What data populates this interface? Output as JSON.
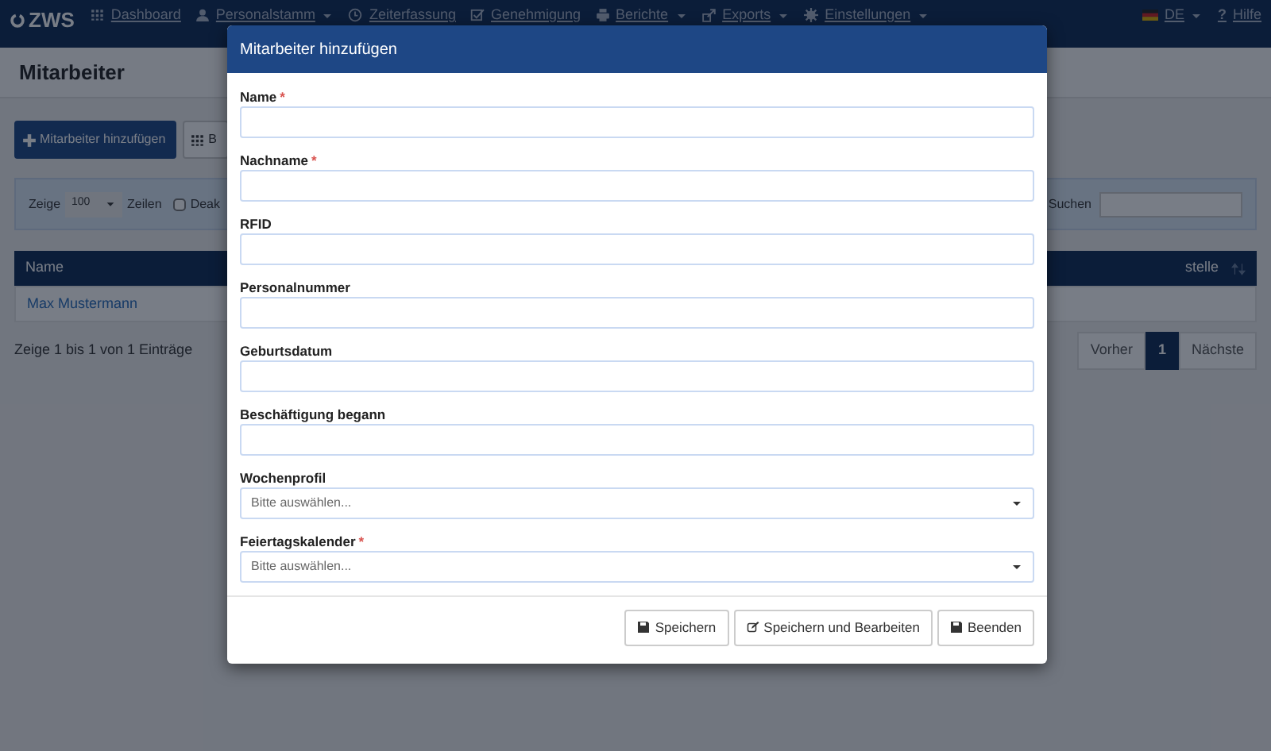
{
  "navbar": {
    "brand": "ZWS",
    "items": [
      {
        "label": "Dashboard",
        "dropdown": false
      },
      {
        "label": "Personalstamm",
        "dropdown": true
      },
      {
        "label": "Zeiterfassung",
        "dropdown": false
      },
      {
        "label": "Genehmigung",
        "dropdown": false
      },
      {
        "label": "Berichte",
        "dropdown": true
      },
      {
        "label": "Exports",
        "dropdown": true
      },
      {
        "label": "Einstellungen",
        "dropdown": true
      }
    ],
    "language": "DE",
    "help_icon": "?",
    "help": "Hilfe"
  },
  "page": {
    "title": "Mitarbeiter",
    "buttons": [
      {
        "label": "Mitarbeiter hinzufügen",
        "kind": "primary"
      },
      {
        "label": "B",
        "kind": "default"
      }
    ],
    "filter": {
      "show_label": "Zeige",
      "rows_value": "100",
      "rows_label": "Zeilen",
      "checkbox_label": "Deak",
      "checked": false,
      "search_label": "Suchen"
    },
    "table": {
      "columns": [
        "Name",
        "stelle"
      ],
      "rows": [
        [
          "Max Mustermann"
        ]
      ]
    },
    "info": "Zeige 1 bis 1 von 1 Einträge",
    "pagination": [
      {
        "label": "Vorher",
        "selected": false
      },
      {
        "label": "1",
        "selected": true
      },
      {
        "label": "Nächste",
        "selected": false
      }
    ]
  },
  "modal": {
    "title": "Mitarbeiter hinzufügen",
    "fields": [
      {
        "label": "Name",
        "required_mark": "*",
        "kind": "text"
      },
      {
        "label": "Nachname",
        "required_mark": "*",
        "kind": "text"
      },
      {
        "label": "RFID",
        "kind": "text"
      },
      {
        "label": "Personalnummer",
        "kind": "text"
      },
      {
        "label": "Geburtsdatum",
        "kind": "text"
      },
      {
        "label": "Beschäftigung begann",
        "kind": "text"
      },
      {
        "label": "Wochenprofil",
        "kind": "select",
        "placeholder": "Bitte auswählen..."
      },
      {
        "label": "Feiertagskalender",
        "required_mark": "*",
        "kind": "select",
        "placeholder": "Bitte auswählen..."
      }
    ],
    "buttons": [
      {
        "label": "Speichern"
      },
      {
        "label": "Speichern und Bearbeiten"
      },
      {
        "label": "Beenden"
      }
    ]
  }
}
